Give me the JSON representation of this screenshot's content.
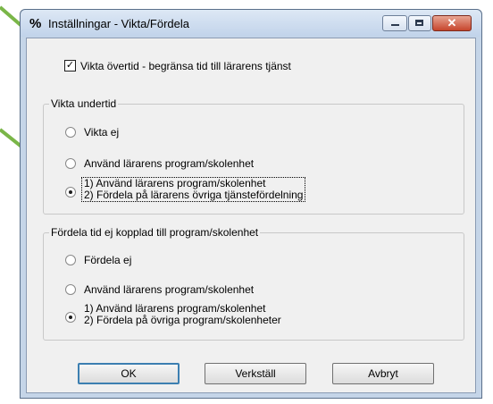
{
  "window": {
    "title": "Inställningar - Vikta/Fördela",
    "icon_glyph": "%",
    "controls": {
      "minimize_icon": "minimize-icon",
      "maximize_icon": "maximize-icon",
      "close_icon": "close-icon",
      "close_glyph": "✕"
    }
  },
  "checkbox": {
    "label": "Vikta övertid - begränsa tid till lärarens tjänst",
    "checked": true,
    "glyph": "✓"
  },
  "group_vikta": {
    "legend": "Vikta undertid",
    "options": [
      {
        "label": "Vikta ej",
        "selected": false
      },
      {
        "label": "Använd lärarens program/skolenhet",
        "selected": false
      },
      {
        "line1": "1) Använd lärarens program/skolenhet",
        "line2": "2) Fördela på lärarens övriga tjänstefördelning",
        "selected": true
      }
    ]
  },
  "group_fordela": {
    "legend": "Fördela tid ej kopplad till program/skolenhet",
    "options": [
      {
        "label": "Fördela ej",
        "selected": false
      },
      {
        "label": "Använd lärarens program/skolenhet",
        "selected": false
      },
      {
        "line1": "1) Använd lärarens program/skolenhet",
        "line2": "2) Fördela på övriga program/skolenheter",
        "selected": true
      }
    ]
  },
  "buttons": {
    "ok": "OK",
    "apply": "Verkställ",
    "cancel": "Avbryt"
  },
  "colors": {
    "annotation_arrow": "#7ab648",
    "title_bar": "#c5d5e8",
    "client_bg": "#f0f0f0"
  }
}
